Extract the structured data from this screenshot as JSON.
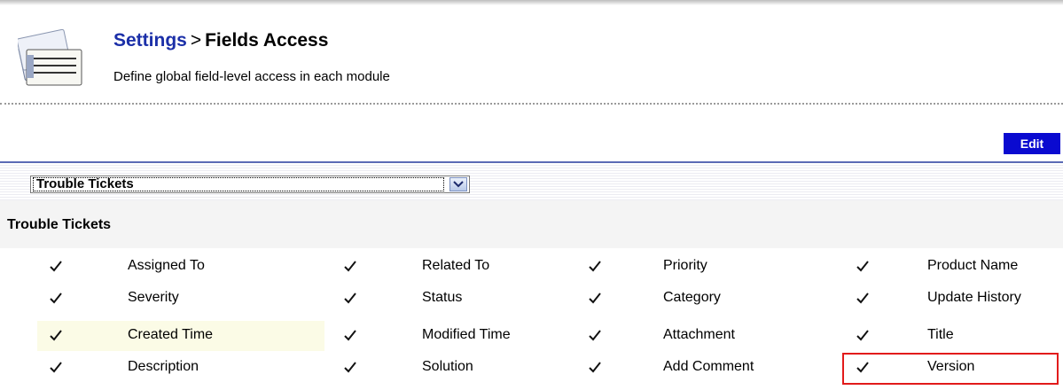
{
  "header": {
    "settings_link": "Settings",
    "separator": ">",
    "page_title": "Fields Access",
    "subtitle": "Define global field-level access in each module"
  },
  "toolbar": {
    "edit_label": "Edit"
  },
  "module_select": {
    "selected": "Trouble Tickets"
  },
  "section": {
    "title": "Trouble Tickets"
  },
  "fields": [
    [
      {
        "label": "Assigned To",
        "checked": true
      },
      {
        "label": "Related To",
        "checked": true
      },
      {
        "label": "Priority",
        "checked": true
      },
      {
        "label": "Product Name",
        "checked": true
      }
    ],
    [
      {
        "label": "Severity",
        "checked": true
      },
      {
        "label": "Status",
        "checked": true
      },
      {
        "label": "Category",
        "checked": true
      },
      {
        "label": "Update History",
        "checked": true
      }
    ],
    [
      {
        "label": "Created Time",
        "checked": true
      },
      {
        "label": "Modified Time",
        "checked": true
      },
      {
        "label": "Attachment",
        "checked": true
      },
      {
        "label": "Title",
        "checked": true
      }
    ],
    [
      {
        "label": "Description",
        "checked": true
      },
      {
        "label": "Solution",
        "checked": true
      },
      {
        "label": "Add Comment",
        "checked": true
      },
      {
        "label": "Version",
        "checked": true
      }
    ]
  ],
  "colors": {
    "link": "#1b2fa8",
    "edit_button": "#0a0ad0",
    "highlight_box": "#e21b1b"
  },
  "icons": {
    "header": "settings-fields-icon",
    "checkmark": "checkmark-icon",
    "dropdown": "chevron-down-icon"
  }
}
